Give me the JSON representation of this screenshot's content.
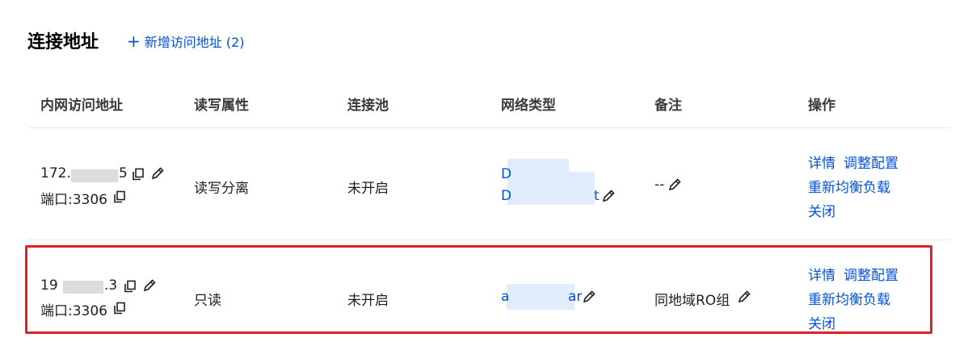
{
  "header": {
    "title": "连接地址",
    "add_label": "新增访问地址 (2)"
  },
  "columns": [
    "内网访问地址",
    "读写属性",
    "连接池",
    "网络类型",
    "备注",
    "操作"
  ],
  "rows": [
    {
      "ip_prefix": "172.",
      "ip_suffix": "5",
      "port": "端口:3306",
      "rw": "读写分离",
      "pool": "未开启",
      "net_line1": "D",
      "net_line2_start": "D",
      "net_line2_end": "t",
      "remark": "--",
      "ops": [
        "详情",
        "调整配置",
        "重新均衡负载",
        "关闭"
      ]
    },
    {
      "ip_prefix": "19",
      "ip_suffix": ".3",
      "port": "端口:3306",
      "rw": "只读",
      "pool": "未开启",
      "net_start": "a",
      "net_end": "ar",
      "remark": "同地域RO组",
      "ops": [
        "详情",
        "调整配置",
        "重新均衡负载",
        "关闭"
      ]
    }
  ],
  "colors": {
    "link": "#0052d9",
    "highlight_border": "#e02121",
    "masked_ip": "#dcdcdc",
    "masked_net": "#e1edfc"
  }
}
